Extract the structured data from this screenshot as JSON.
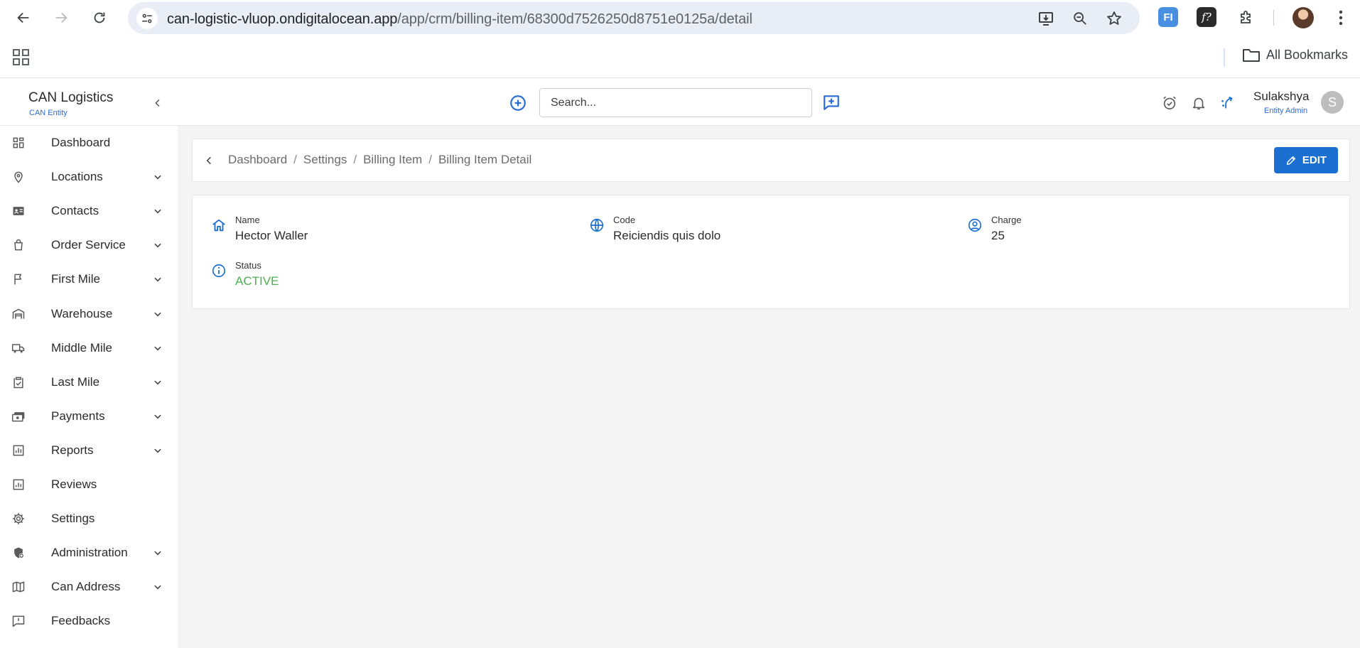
{
  "browser": {
    "url_host": "can-logistic-vluop.ondigitalocean.app",
    "url_path": "/app/crm/billing-item/68300d7526250d8751e0125a/detail",
    "bookmarks_label": "All Bookmarks",
    "icons": [
      "back-icon",
      "forward-icon",
      "reload-icon",
      "site-settings-icon",
      "install-icon",
      "zoom-icon",
      "star-icon",
      "extension-fi-icon",
      "extension-f-icon",
      "extensions-puzzle-icon",
      "profile-avatar",
      "menu-dots-icon",
      "apps-grid-icon",
      "folder-icon"
    ],
    "ext_fi_text": "FI",
    "ext_f_text": "f?"
  },
  "header": {
    "brand_title": "CAN Logistics",
    "brand_subtitle": "CAN Entity",
    "search_placeholder": "Search...",
    "user_name": "Sulakshya",
    "user_role": "Entity Admin",
    "avatar_initial": "S",
    "accent_color": "#1b6fd0"
  },
  "sidebar": {
    "items": [
      {
        "label": "Dashboard",
        "icon": "dashboard-icon",
        "expandable": false
      },
      {
        "label": "Locations",
        "icon": "location-pin-icon",
        "expandable": true
      },
      {
        "label": "Contacts",
        "icon": "contact-card-icon",
        "expandable": true
      },
      {
        "label": "Order Service",
        "icon": "shopping-bag-icon",
        "expandable": true
      },
      {
        "label": "First Mile",
        "icon": "flag-icon",
        "expandable": true
      },
      {
        "label": "Warehouse",
        "icon": "warehouse-icon",
        "expandable": true
      },
      {
        "label": "Middle Mile",
        "icon": "truck-icon",
        "expandable": true
      },
      {
        "label": "Last Mile",
        "icon": "clipboard-check-icon",
        "expandable": true
      },
      {
        "label": "Payments",
        "icon": "payments-icon",
        "expandable": true
      },
      {
        "label": "Reports",
        "icon": "bar-chart-icon",
        "expandable": true
      },
      {
        "label": "Reviews",
        "icon": "reviews-chart-icon",
        "expandable": false
      },
      {
        "label": "Settings",
        "icon": "gear-icon",
        "expandable": false
      },
      {
        "label": "Administration",
        "icon": "admin-shield-icon",
        "expandable": true
      },
      {
        "label": "Can Address",
        "icon": "map-icon",
        "expandable": true
      },
      {
        "label": "Feedbacks",
        "icon": "feedback-icon",
        "expandable": false
      }
    ]
  },
  "breadcrumb": {
    "items": [
      "Dashboard",
      "Settings",
      "Billing Item",
      "Billing Item Detail"
    ],
    "separator": "/"
  },
  "actions": {
    "edit_label": "EDIT"
  },
  "detail": {
    "name_label": "Name",
    "name_value": "Hector Waller",
    "code_label": "Code",
    "code_value": "Reiciendis quis dolo",
    "charge_label": "Charge",
    "charge_value": "25",
    "status_label": "Status",
    "status_value": "ACTIVE",
    "status_color": "#4caf50"
  }
}
